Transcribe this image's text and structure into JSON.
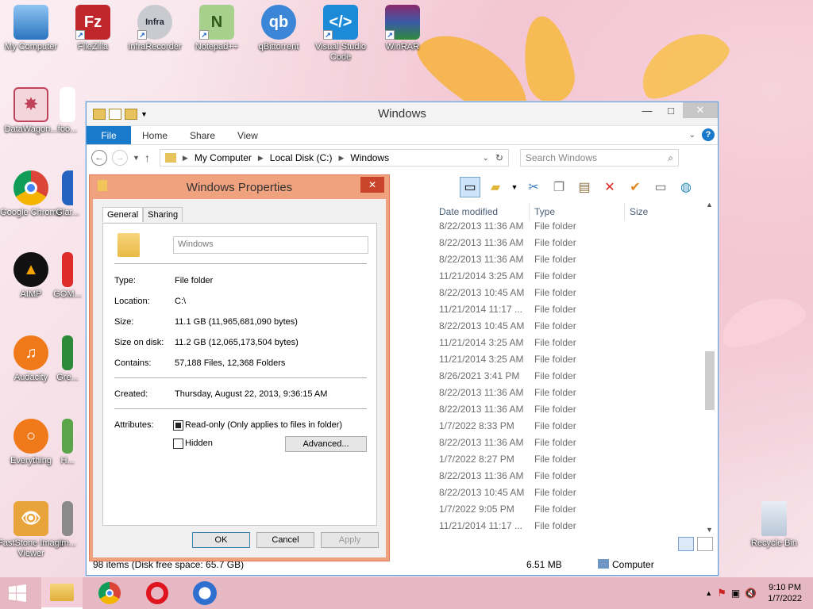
{
  "desktop_icons": [
    {
      "label": "My Computer"
    },
    {
      "label": "FileZilla"
    },
    {
      "label": "InfraRecorder"
    },
    {
      "label": "Notepad++"
    },
    {
      "label": "qBittorrent"
    },
    {
      "label": "Visual Studio Code"
    },
    {
      "label": "WinRAR"
    },
    {
      "label": "DataWagon..."
    },
    {
      "label": "foo..."
    },
    {
      "label": "Google Chrome"
    },
    {
      "label": "Glar..."
    },
    {
      "label": "AIMP"
    },
    {
      "label": "GOM..."
    },
    {
      "label": "Audacity"
    },
    {
      "label": "Gre..."
    },
    {
      "label": "Everything"
    },
    {
      "label": "H..."
    },
    {
      "label": "FastStone Image Viewer"
    },
    {
      "label": "Im..."
    },
    {
      "label": "Recycle Bin"
    }
  ],
  "explorer": {
    "title": "Windows",
    "ribbon_tabs": [
      "File",
      "Home",
      "Share",
      "View"
    ],
    "help": "?",
    "breadcrumb": [
      "My Computer",
      "Local Disk (C:)",
      "Windows"
    ],
    "search_placeholder": "Search Windows",
    "columns": [
      "Date modified",
      "Type",
      "Size"
    ],
    "rows": [
      {
        "date": "8/22/2013 11:36 AM",
        "type": "File folder"
      },
      {
        "date": "8/22/2013 11:36 AM",
        "type": "File folder"
      },
      {
        "date": "8/22/2013 11:36 AM",
        "type": "File folder"
      },
      {
        "date": "11/21/2014 3:25 AM",
        "type": "File folder"
      },
      {
        "date": "8/22/2013 10:45 AM",
        "type": "File folder"
      },
      {
        "date": "11/21/2014 11:17 ...",
        "type": "File folder"
      },
      {
        "date": "8/22/2013 10:45 AM",
        "type": "File folder"
      },
      {
        "date": "11/21/2014 3:25 AM",
        "type": "File folder"
      },
      {
        "date": "11/21/2014 3:25 AM",
        "type": "File folder"
      },
      {
        "date": "8/26/2021 3:41 PM",
        "type": "File folder"
      },
      {
        "date": "8/22/2013 11:36 AM",
        "type": "File folder"
      },
      {
        "date": "8/22/2013 11:36 AM",
        "type": "File folder"
      },
      {
        "date": "1/7/2022 8:33 PM",
        "type": "File folder"
      },
      {
        "date": "8/22/2013 11:36 AM",
        "type": "File folder"
      },
      {
        "date": "1/7/2022 8:27 PM",
        "type": "File folder"
      },
      {
        "date": "8/22/2013 11:36 AM",
        "type": "File folder"
      },
      {
        "date": "8/22/2013 10:45 AM",
        "type": "File folder"
      },
      {
        "date": "1/7/2022 9:05 PM",
        "type": "File folder"
      },
      {
        "date": "11/21/2014 11:17 ...",
        "type": "File folder"
      }
    ],
    "status_left": "98 items (Disk free space: 65.7 GB)",
    "status_size": "6.51 MB",
    "status_location": "Computer"
  },
  "properties": {
    "title": "Windows Properties",
    "tabs": [
      "General",
      "Sharing"
    ],
    "name_value": "Windows",
    "fields": {
      "type_label": "Type:",
      "type_value": "File folder",
      "location_label": "Location:",
      "location_value": "C:\\",
      "size_label": "Size:",
      "size_value": "11.1 GB (11,965,681,090 bytes)",
      "size_on_disk_label": "Size on disk:",
      "size_on_disk_value": "11.2 GB (12,065,173,504 bytes)",
      "contains_label": "Contains:",
      "contains_value": "57,188 Files, 12,368 Folders",
      "created_label": "Created:",
      "created_value": "Thursday, August 22, 2013, 9:36:15 AM",
      "attributes_label": "Attributes:",
      "readonly_label": "Read-only (Only applies to files in folder)",
      "hidden_label": "Hidden"
    },
    "buttons": {
      "advanced": "Advanced...",
      "ok": "OK",
      "cancel": "Cancel",
      "apply": "Apply"
    }
  },
  "taskbar": {
    "time": "9:10 PM",
    "date": "1/7/2022"
  }
}
